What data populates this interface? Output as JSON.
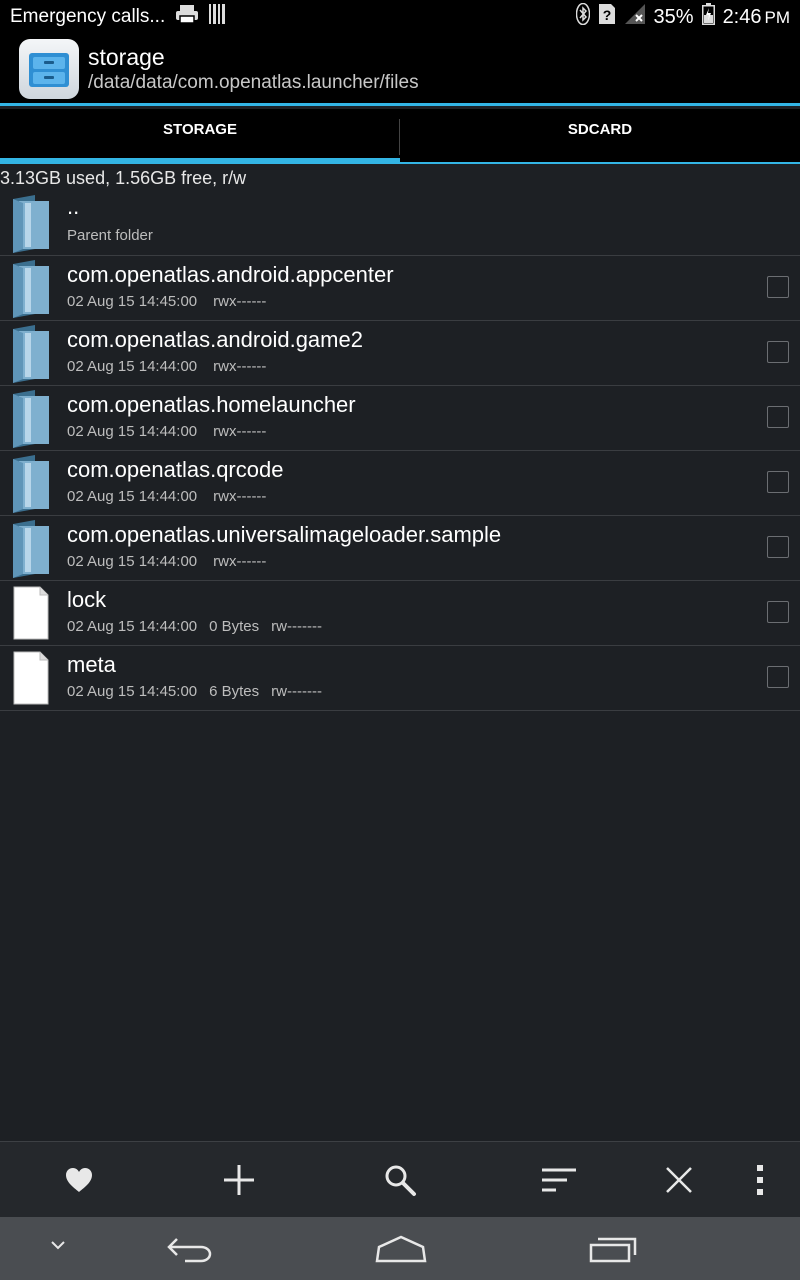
{
  "statusbar": {
    "left_text": "Emergency calls...",
    "battery": "35%",
    "time": "2:46",
    "ampm": "PM"
  },
  "actionbar": {
    "title": "storage",
    "subtitle": "/data/data/com.openatlas.launcher/files"
  },
  "tabs": [
    {
      "label": "STORAGE",
      "active": true
    },
    {
      "label": "SDCARD",
      "active": false
    }
  ],
  "storage_info": "3.13GB used, 1.56GB free, r/w",
  "files": [
    {
      "name": "..",
      "meta": "Parent folder",
      "type": "parent"
    },
    {
      "name": "com.openatlas.android.appcenter",
      "date": "02 Aug 15 14:45:00",
      "size": "",
      "perm": "rwx------",
      "type": "folder"
    },
    {
      "name": "com.openatlas.android.game2",
      "date": "02 Aug 15 14:44:00",
      "size": "",
      "perm": "rwx------",
      "type": "folder"
    },
    {
      "name": "com.openatlas.homelauncher",
      "date": "02 Aug 15 14:44:00",
      "size": "",
      "perm": "rwx------",
      "type": "folder"
    },
    {
      "name": "com.openatlas.qrcode",
      "date": "02 Aug 15 14:44:00",
      "size": "",
      "perm": "rwx------",
      "type": "folder"
    },
    {
      "name": "com.openatlas.universalimageloader.sample",
      "date": "02 Aug 15 14:44:00",
      "size": "",
      "perm": "rwx------",
      "type": "folder"
    },
    {
      "name": "lock",
      "date": "02 Aug 15 14:44:00",
      "size": "0 Bytes",
      "perm": "rw-------",
      "type": "file"
    },
    {
      "name": "meta",
      "date": "02 Aug 15 14:45:00",
      "size": "6 Bytes",
      "perm": "rw-------",
      "type": "file"
    }
  ],
  "toolbar": {
    "icons": [
      "heart-icon",
      "plus-icon",
      "search-icon",
      "sort-icon",
      "close-icon",
      "overflow-menu-icon"
    ]
  },
  "navbar": {
    "icons": [
      "hide-keyboard-icon",
      "back-icon",
      "home-icon",
      "recents-icon"
    ]
  },
  "colors": {
    "accent": "#33b5e5",
    "background": "#1d2024"
  }
}
